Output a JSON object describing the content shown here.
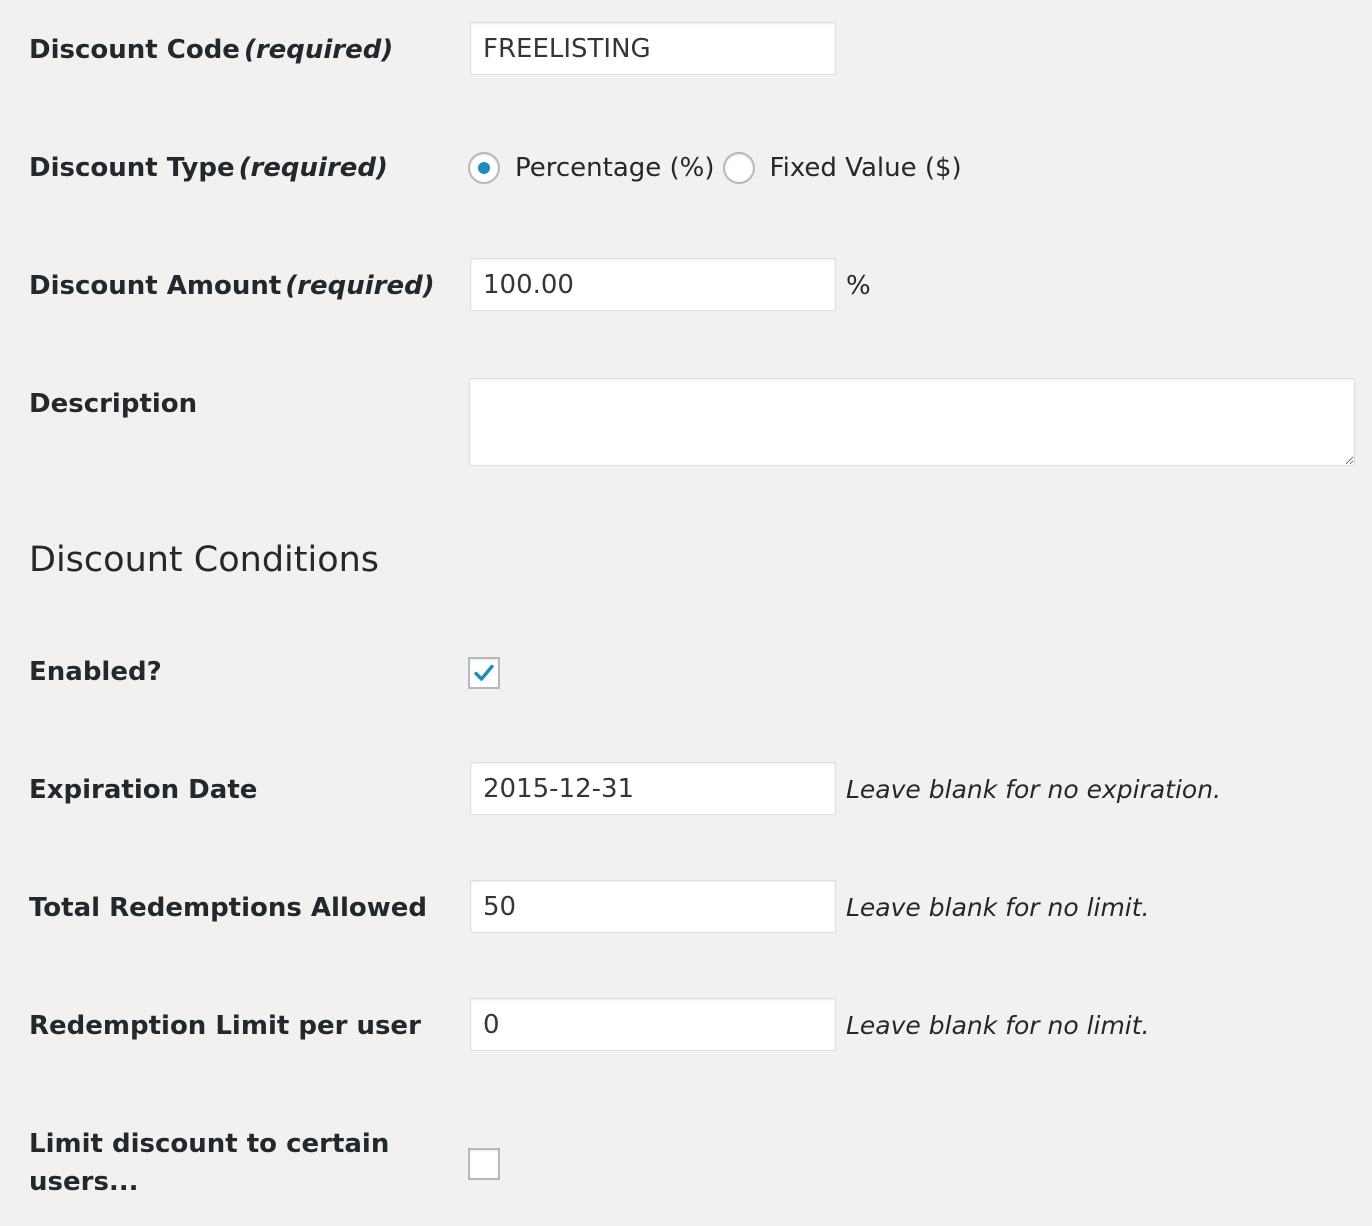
{
  "discount_code": {
    "label": "Discount Code",
    "required": "(required)",
    "value": "FREELISTING"
  },
  "discount_type": {
    "label": "Discount Type",
    "required": "(required)",
    "options": [
      {
        "label": "Percentage (%)",
        "checked": true
      },
      {
        "label": "Fixed Value ($)",
        "checked": false
      }
    ]
  },
  "discount_amount": {
    "label": "Discount Amount",
    "required": "(required)",
    "value": "100.00",
    "suffix": "%"
  },
  "description": {
    "label": "Description",
    "value": ""
  },
  "conditions": {
    "title": "Discount Conditions",
    "enabled": {
      "label": "Enabled?",
      "checked": true
    },
    "expiration": {
      "label": "Expiration Date",
      "value": "2015-12-31",
      "hint": "Leave blank for no expiration."
    },
    "total_redemptions": {
      "label": "Total Redemptions Allowed",
      "value": "50",
      "hint": "Leave blank for no limit."
    },
    "per_user_limit": {
      "label": "Redemption Limit per user",
      "value": "0",
      "hint": "Leave blank for no limit."
    },
    "limit_users": {
      "label_line1": "Limit discount to certain",
      "label_line2": "users...",
      "checked": false
    }
  },
  "colors": {
    "accent": "#1e8cbe",
    "background": "#f1f1f1",
    "text": "#23282d",
    "input_border": "#dddddd"
  },
  "icons": {
    "checkmark": "checkmark-icon"
  }
}
